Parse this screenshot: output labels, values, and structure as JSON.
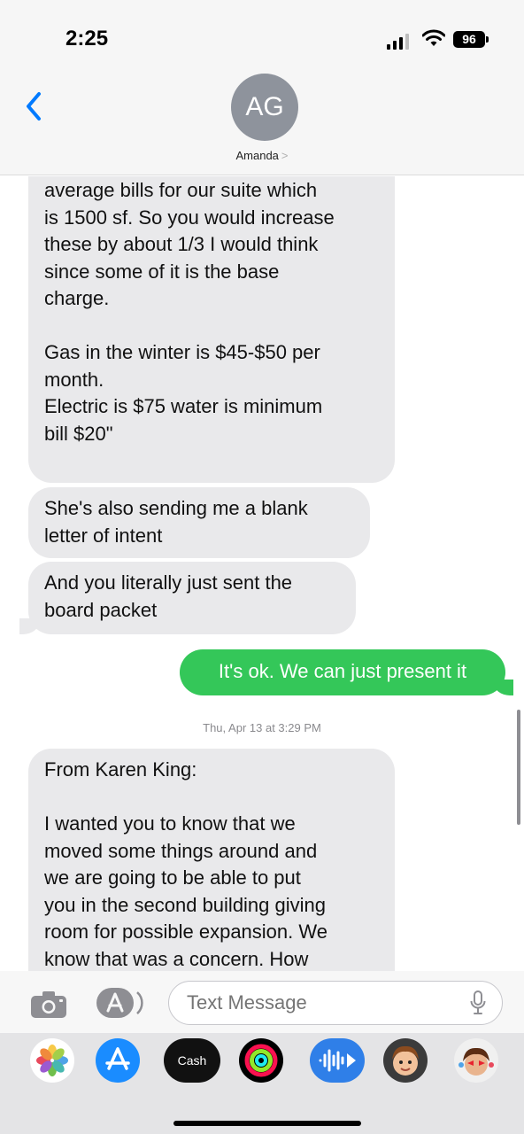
{
  "status_bar": {
    "time": "2:25",
    "battery": "96",
    "icons": [
      "cellular-signal-icon",
      "wifi-icon",
      "battery-icon"
    ]
  },
  "header": {
    "avatar_initials": "AG",
    "contact_name": "Amanda",
    "contact_chevron": ">",
    "icons": [
      "back-chevron-icon"
    ]
  },
  "conversation": {
    "messages": [
      {
        "direction": "received",
        "lines": [
          "average bills for our suite which",
          "is 1500 sf. So you would increase",
          "these by about 1/3 I would think",
          "since some of it is the base",
          "charge.",
          "",
          "Gas in the winter is $45-$50 per",
          "month.",
          "Electric is $75 water is minimum",
          "bill $20\""
        ]
      },
      {
        "direction": "received",
        "lines": [
          "She's also sending me a blank",
          "letter of intent"
        ]
      },
      {
        "direction": "received",
        "lines": [
          "And you literally just sent the",
          "board packet"
        ]
      },
      {
        "direction": "sent",
        "lines": [
          "It's ok. We can just present it"
        ]
      },
      {
        "direction": "received",
        "lines": [
          "From Karen King:",
          "",
          "I wanted you to know that we",
          "moved some things around and",
          "we are going to be able to put",
          "you in the second building giving",
          "room for possible expansion. We",
          "know that was a concern. How"
        ]
      }
    ],
    "timestamp": "Thu, Apr 13 at 3:29 PM"
  },
  "input_bar": {
    "placeholder": "Text Message",
    "icons": [
      "camera-icon",
      "apps-icon",
      "microphone-icon"
    ]
  },
  "app_tray": {
    "apps": [
      {
        "name": "photos-app-icon",
        "label": ""
      },
      {
        "name": "app-store-icon",
        "label": ""
      },
      {
        "name": "apple-cash-icon",
        "label": "Cash"
      },
      {
        "name": "activity-icon",
        "label": ""
      },
      {
        "name": "audio-message-icon",
        "label": ""
      },
      {
        "name": "memoji-icon",
        "label": ""
      },
      {
        "name": "memoji-stickers-icon",
        "label": ""
      }
    ]
  },
  "colors": {
    "sent_bubble": "#34c759",
    "received_bubble": "#e9e9eb",
    "ios_blue": "#007aff",
    "avatar_gray": "#8e939c"
  }
}
